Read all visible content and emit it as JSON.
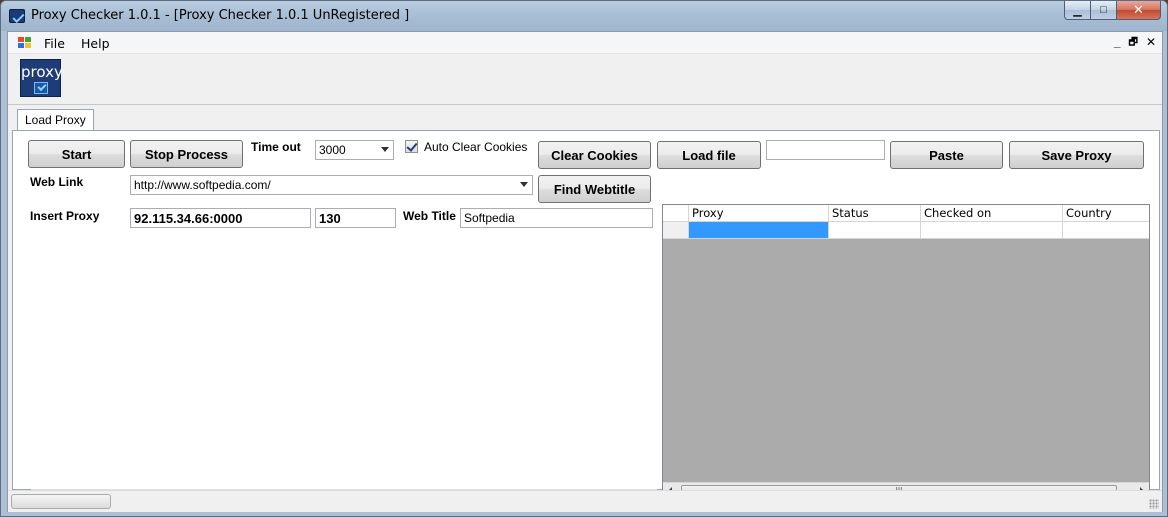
{
  "window": {
    "title": "Proxy Checker 1.0.1 - [Proxy Checker 1.0.1 UnRegistered ]",
    "minimize_glyph": "▁",
    "maximize_glyph": "□",
    "close_glyph": "✕"
  },
  "menu": {
    "items": [
      "File",
      "Help"
    ],
    "mdi_controls": [
      "_",
      "🗗",
      "✕"
    ]
  },
  "logo": {
    "text": "proxy",
    "icon": "proxy-check-logo"
  },
  "tabs": [
    {
      "label": "Load Proxy",
      "active": true
    }
  ],
  "controls": {
    "start_label": "Start",
    "stop_label": "Stop Process",
    "timeout_label": "Time out",
    "timeout_value": "3000",
    "auto_clear_label": "Auto Clear Cookies",
    "auto_clear_checked": true,
    "clear_cookies_label": "Clear Cookies",
    "load_file_label": "Load file",
    "load_file_path": "",
    "paste_label": "Paste",
    "save_proxy_label": "Save Proxy",
    "web_link_label": "Web Link",
    "web_link_value": "http://www.softpedia.com/",
    "find_webtitle_label": "Find Webtitle",
    "insert_proxy_label": "Insert Proxy",
    "insert_proxy_value": "92.115.34.66:0000",
    "port_value": "130",
    "web_title_label": "Web Title",
    "web_title_value": "Softpedia"
  },
  "grid": {
    "columns": [
      "",
      "Proxy",
      "Status",
      "Checked on",
      "Country"
    ],
    "rows": [
      [
        "",
        "",
        "",
        "",
        ""
      ]
    ],
    "scroll_thumb_glyph": "III"
  },
  "colors": {
    "selection": "#3399ff",
    "grid_background": "#ababab"
  }
}
